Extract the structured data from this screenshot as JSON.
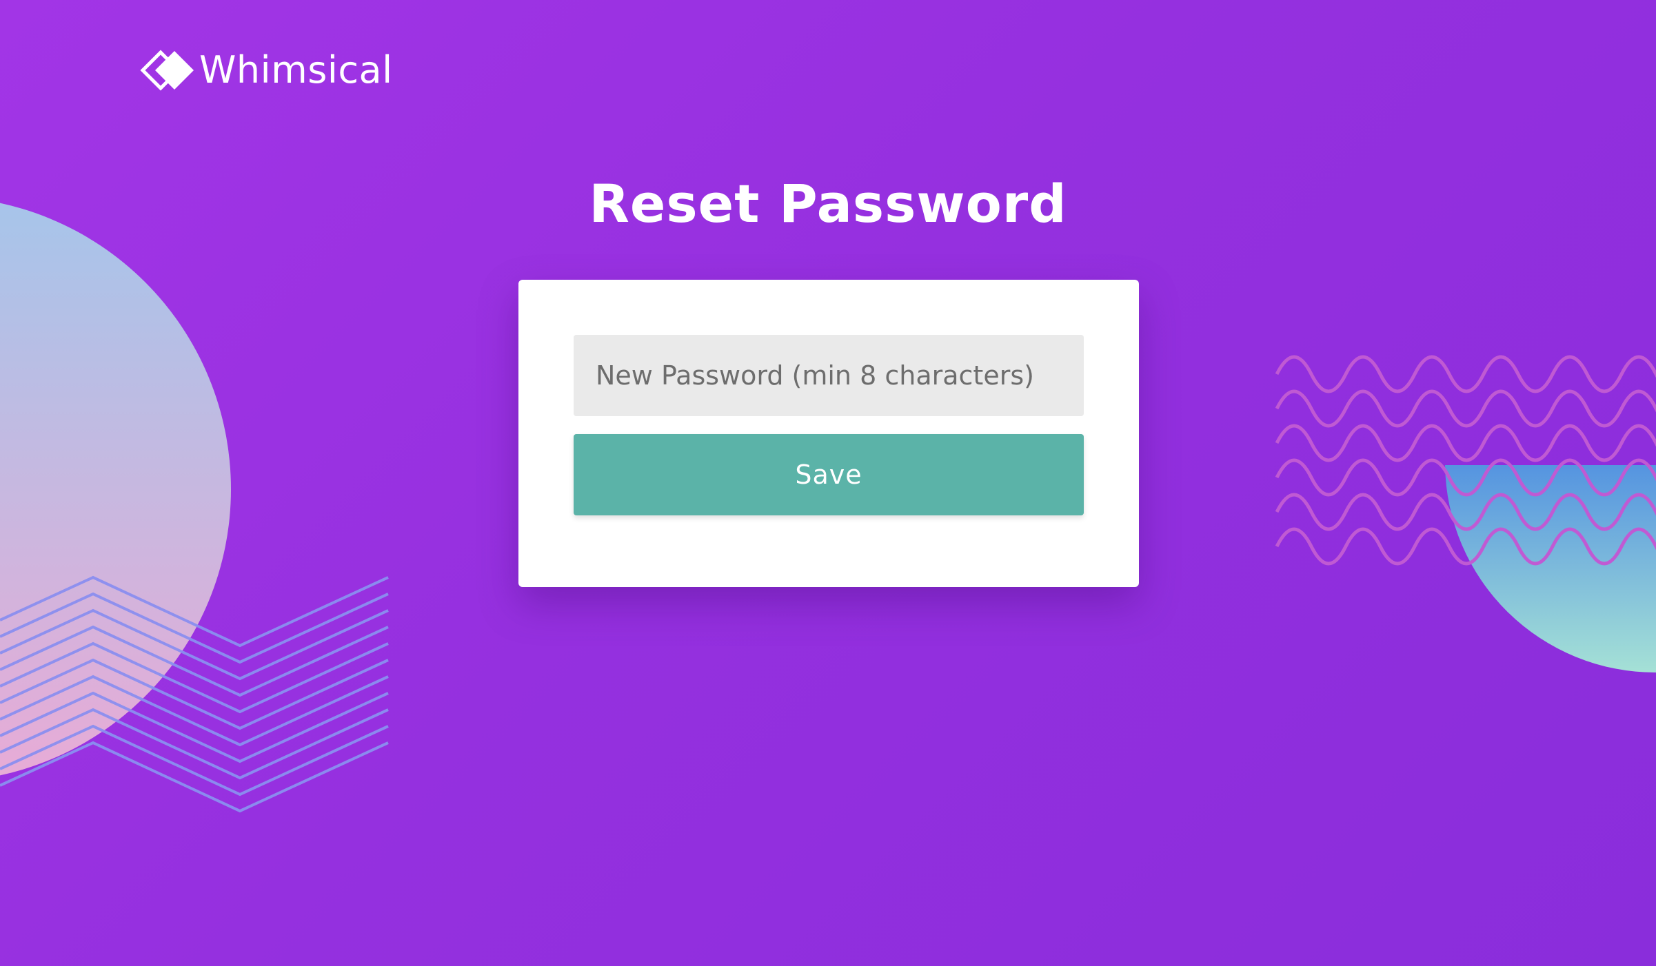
{
  "brand": {
    "name": "Whimsical"
  },
  "page": {
    "title": "Reset Password"
  },
  "form": {
    "password_value": "",
    "password_placeholder": "New Password (min 8 characters)",
    "save_label": "Save"
  },
  "colors": {
    "background_start": "#a235e6",
    "background_end": "#8a2ddb",
    "card": "#ffffff",
    "input_background": "#eaeaea",
    "button": "#5bb3a8",
    "text_on_dark": "#ffffff"
  }
}
